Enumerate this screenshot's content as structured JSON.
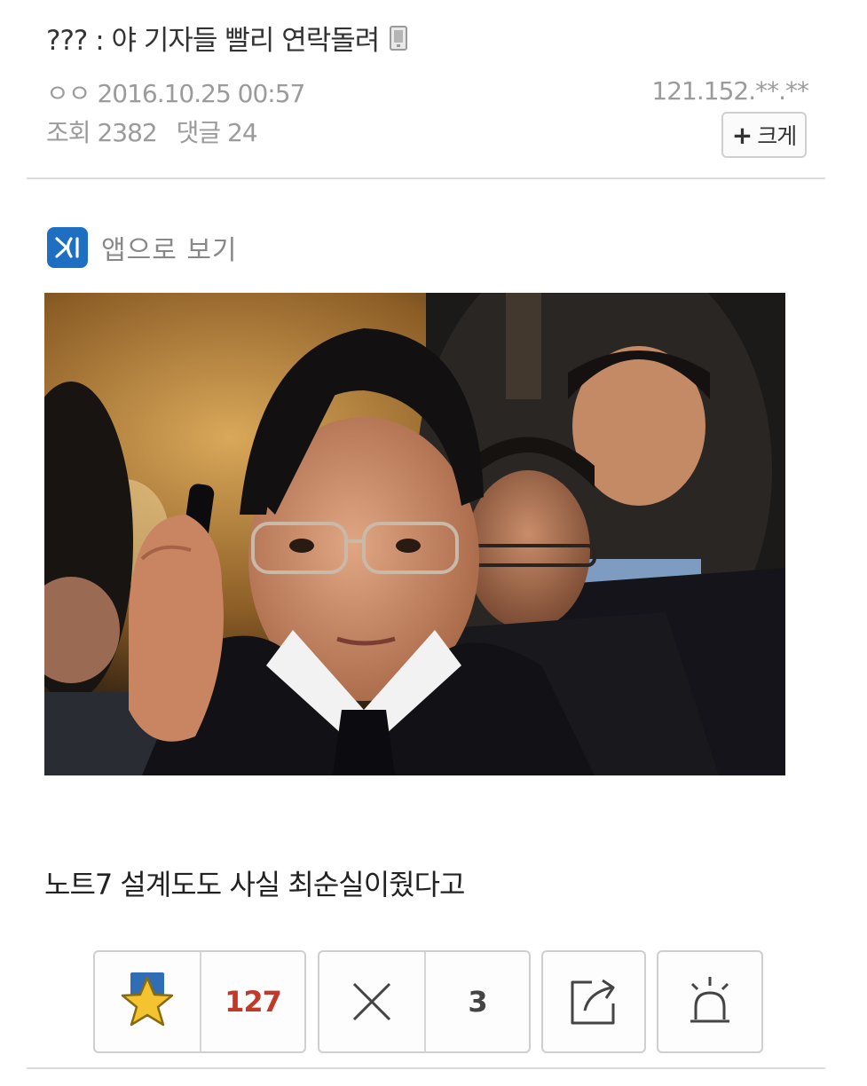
{
  "post": {
    "title": "??? : 야 기자들 빨리 연락돌려",
    "author": "ㅇㅇ",
    "datetime": "2016.10.25 00:57",
    "ip": "121.152.**.**",
    "views_label": "조회",
    "views": "2382",
    "comments_label": "댓글",
    "comments": "24",
    "zoom_label": "크게",
    "app_view_label": "앱으로 보기",
    "body_text": "노트7 설계도도 사실 최순실이줬다고"
  },
  "actions": {
    "recommend_count": "127",
    "downvote_count": "3"
  },
  "colors": {
    "app_logo": "#1e6fc2",
    "recommend_count": "#c0392b",
    "star": "#f4c430",
    "star_flag": "#2f6db5"
  },
  "icons": [
    "mobile-icon",
    "app-logo-icon",
    "star-icon",
    "x-icon",
    "share-icon",
    "siren-icon"
  ]
}
